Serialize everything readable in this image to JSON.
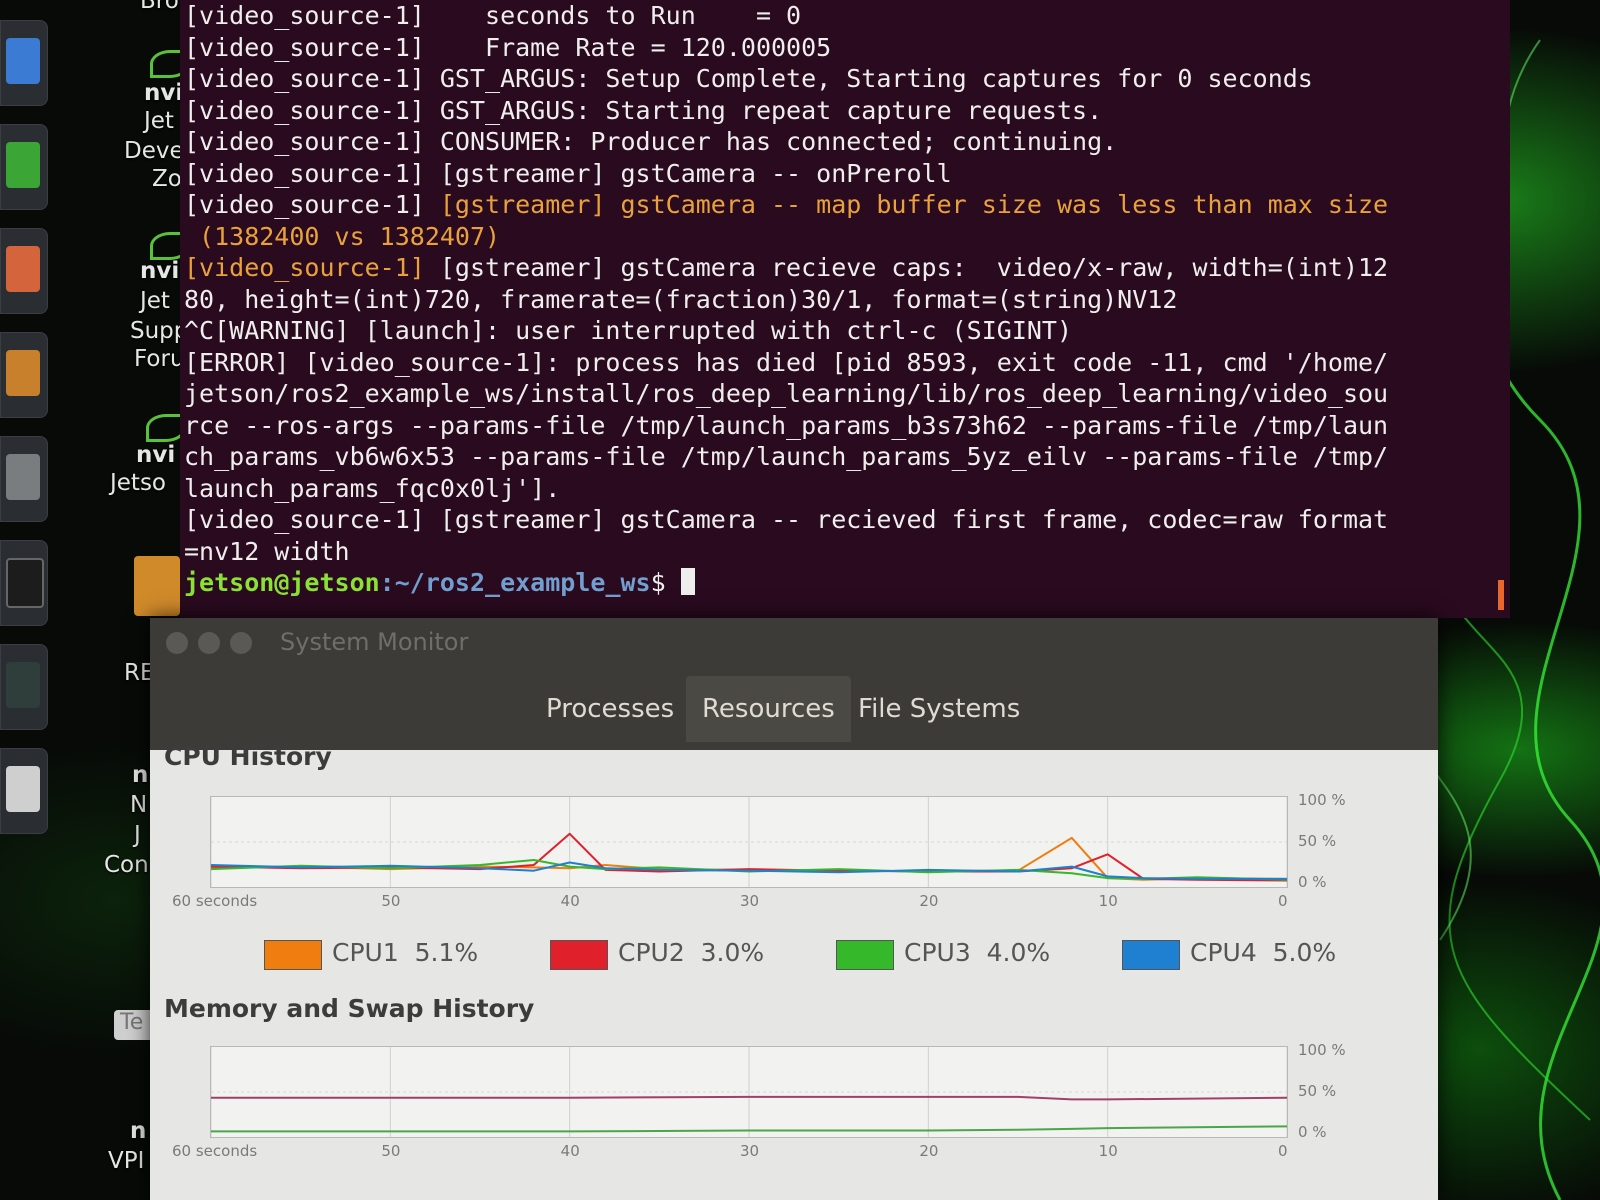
{
  "desktop": {
    "icon_labels": [
      "Bro",
      "nvi",
      "Jet",
      "Devel",
      "Zo",
      "nvi",
      "Jet",
      "Supp",
      "Foru",
      "nvi",
      "Jetso",
      "RE",
      "n",
      "N",
      "J",
      "Con",
      "n",
      "VPI",
      "Te"
    ]
  },
  "terminal": {
    "lines": [
      {
        "text": "[video_source-1]    seconds to Run    = 0",
        "style": "normal"
      },
      {
        "text": "[video_source-1]    Frame Rate = 120.000005",
        "style": "normal"
      },
      {
        "text": "[video_source-1] GST_ARGUS: Setup Complete, Starting captures for 0 seconds",
        "style": "normal"
      },
      {
        "text": "[video_source-1] GST_ARGUS: Starting repeat capture requests.",
        "style": "normal"
      },
      {
        "text": "[video_source-1] CONSUMER: Producer has connected; continuing.",
        "style": "normal"
      },
      {
        "text": "[video_source-1] [gstreamer] gstCamera -- onPreroll",
        "style": "normal"
      },
      {
        "text": "[video_source-1] [gstreamer] gstCamera -- map buffer size was less than max size",
        "style": "warn-tail"
      },
      {
        "text": " (1382400 vs 1382407)",
        "style": "warn"
      },
      {
        "text": "[video_source-1] [gstreamer] gstCamera recieve caps:  video/x-raw, width=(int)12",
        "style": "warn-head"
      },
      {
        "text": "80, height=(int)720, framerate=(fraction)30/1, format=(string)NV12",
        "style": "normal"
      },
      {
        "text": "^C[WARNING] [launch]: user interrupted with ctrl-c (SIGINT)",
        "style": "normal"
      },
      {
        "text": "[ERROR] [video_source-1]: process has died [pid 8593, exit code -11, cmd '/home/",
        "style": "normal"
      },
      {
        "text": "jetson/ros2_example_ws/install/ros_deep_learning/lib/ros_deep_learning/video_sou",
        "style": "normal"
      },
      {
        "text": "rce --ros-args --params-file /tmp/launch_params_b3s73h62 --params-file /tmp/laun",
        "style": "normal"
      },
      {
        "text": "ch_params_vb6w6x53 --params-file /tmp/launch_params_5yz_eilv --params-file /tmp/",
        "style": "normal"
      },
      {
        "text": "launch_params_fqc0x0lj'].",
        "style": "normal"
      },
      {
        "text": "[video_source-1] [gstreamer] gstCamera -- recieved first frame, codec=raw format",
        "style": "normal"
      },
      {
        "text": "=nv12 width",
        "style": "normal"
      }
    ],
    "prompt_user": "jetson@jetson",
    "prompt_path": ":~/ros2_example_ws",
    "prompt_symbol": "$ "
  },
  "system_monitor": {
    "title": "System Monitor",
    "tabs": [
      "Processes",
      "Resources",
      "File Systems"
    ],
    "active_tab": "Resources",
    "cpu_section_title": "CPU History",
    "memory_section_title": "Memory and Swap History",
    "x_axis_labels": [
      "60 seconds",
      "50",
      "40",
      "30",
      "20",
      "10",
      "0"
    ],
    "y_axis_labels": [
      "100 %",
      "50 %",
      "0 %"
    ],
    "legend": [
      {
        "label": "CPU1",
        "value": "5.1%",
        "color": "#f07d0f"
      },
      {
        "label": "CPU2",
        "value": "3.0%",
        "color": "#e0202a"
      },
      {
        "label": "CPU3",
        "value": "4.0%",
        "color": "#35b82a"
      },
      {
        "label": "CPU4",
        "value": "5.0%",
        "color": "#1f7fd0"
      }
    ]
  },
  "chart_data": [
    {
      "type": "line",
      "title": "CPU History",
      "xlabel": "",
      "ylabel": "",
      "x": [
        60,
        55,
        50,
        45,
        42,
        40,
        38,
        35,
        30,
        25,
        20,
        15,
        12,
        10,
        8,
        5,
        0
      ],
      "ylim": [
        0,
        100
      ],
      "series": [
        {
          "name": "CPU1",
          "values": [
            18,
            20,
            17,
            20,
            19,
            18,
            22,
            17,
            16,
            14,
            15,
            15,
            55,
            6,
            4,
            6,
            5
          ]
        },
        {
          "name": "CPU2",
          "values": [
            20,
            18,
            19,
            17,
            22,
            60,
            16,
            14,
            17,
            15,
            14,
            14,
            18,
            35,
            5,
            4,
            3
          ]
        },
        {
          "name": "CPU3",
          "values": [
            17,
            21,
            18,
            22,
            28,
            20,
            17,
            19,
            14,
            17,
            13,
            16,
            12,
            6,
            5,
            7,
            4
          ]
        },
        {
          "name": "CPU4",
          "values": [
            22,
            19,
            21,
            18,
            15,
            25,
            18,
            16,
            15,
            13,
            16,
            14,
            20,
            8,
            6,
            5,
            5
          ]
        }
      ]
    },
    {
      "type": "line",
      "title": "Memory and Swap History",
      "x": [
        60,
        40,
        30,
        20,
        15,
        12,
        10,
        0
      ],
      "ylim": [
        0,
        100
      ],
      "series": [
        {
          "values": [
            43,
            43,
            44,
            44,
            44,
            41,
            41,
            43
          ]
        },
        {
          "values": [
            2,
            2,
            3,
            3,
            4,
            5,
            6,
            8
          ]
        }
      ]
    }
  ]
}
